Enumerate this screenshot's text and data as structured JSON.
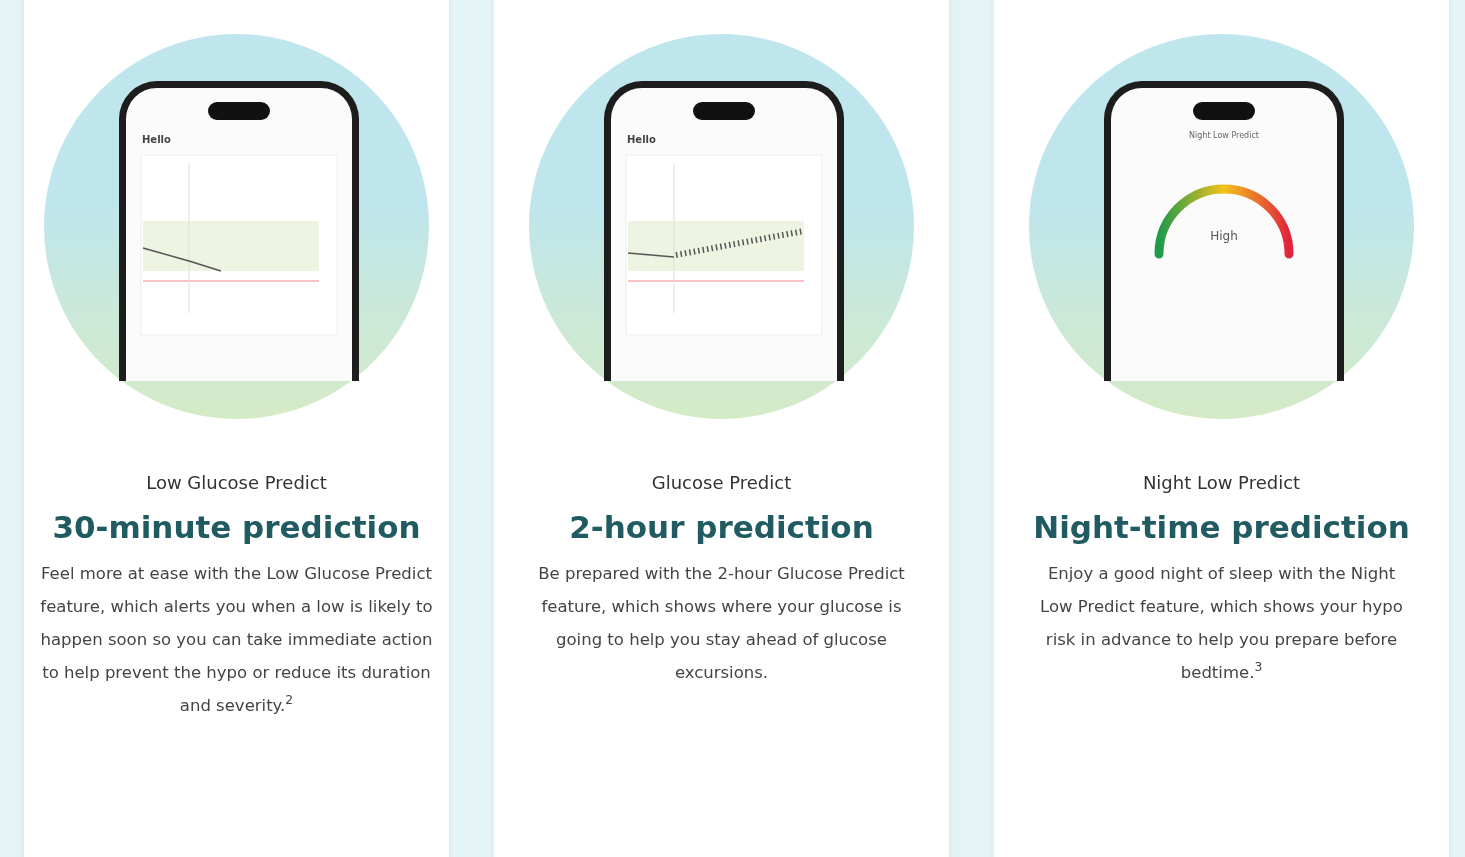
{
  "cards": [
    {
      "subtitle": "Low Glucose Predict",
      "title": "30-minute prediction",
      "body": "Feel more at ease with the Low Glucose Predict feature, which alerts you when a low is likely to happen soon so you can take immediate action to help prevent the hypo or reduce its duration and severity.$^{2}$",
      "screen": {
        "kind": "trend",
        "greeting": "Hello"
      }
    },
    {
      "subtitle": "Glucose Predict",
      "title": "2-hour prediction",
      "body": "Be prepared with the 2-hour Glucose Predict feature, which shows where your glucose is going to help you stay ahead of glucose excursions.",
      "screen": {
        "kind": "forecast",
        "greeting": "Hello"
      }
    },
    {
      "subtitle": "Night Low Predict",
      "title": "Night-time prediction",
      "body": "Enjoy a good night of sleep with the Night Low Predict feature, which shows your hypo risk in advance to help you prepare before bedtime.$^{3}$",
      "screen": {
        "kind": "gauge",
        "heading": "Night Low Predict",
        "risk": "High"
      }
    }
  ]
}
